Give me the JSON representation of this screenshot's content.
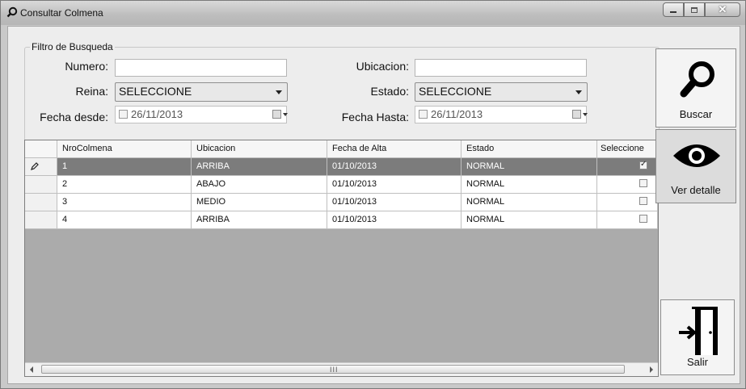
{
  "window": {
    "title": "Consultar Colmena"
  },
  "filter": {
    "legend": "Filtro de Busqueda",
    "numero_label": "Numero:",
    "numero_value": "",
    "ubicacion_label": "Ubicacion:",
    "ubicacion_value": "",
    "reina_label": "Reina:",
    "reina_value": "SELECCIONE",
    "estado_label": "Estado:",
    "estado_value": "SELECCIONE",
    "fecha_desde_label": "Fecha desde:",
    "fecha_desde_value": "26/11/2013",
    "fecha_hasta_label": "Fecha Hasta:",
    "fecha_hasta_value": "26/11/2013"
  },
  "grid": {
    "columns": [
      "NroColmena",
      "Ubicacion",
      "Fecha de Alta",
      "Estado",
      "Seleccione"
    ],
    "rows": [
      {
        "nro": "1",
        "ubicacion": "ARRIBA",
        "fecha": "01/10/2013",
        "estado": "NORMAL",
        "checked": true
      },
      {
        "nro": "2",
        "ubicacion": "ABAJO",
        "fecha": "01/10/2013",
        "estado": "NORMAL",
        "checked": false
      },
      {
        "nro": "3",
        "ubicacion": "MEDIO",
        "fecha": "01/10/2013",
        "estado": "NORMAL",
        "checked": false
      },
      {
        "nro": "4",
        "ubicacion": "ARRIBA",
        "fecha": "01/10/2013",
        "estado": "NORMAL",
        "checked": false
      }
    ],
    "scroll_grip": "III"
  },
  "buttons": {
    "buscar": "Buscar",
    "ver_detalle": "Ver detalle",
    "salir": "Salir"
  }
}
